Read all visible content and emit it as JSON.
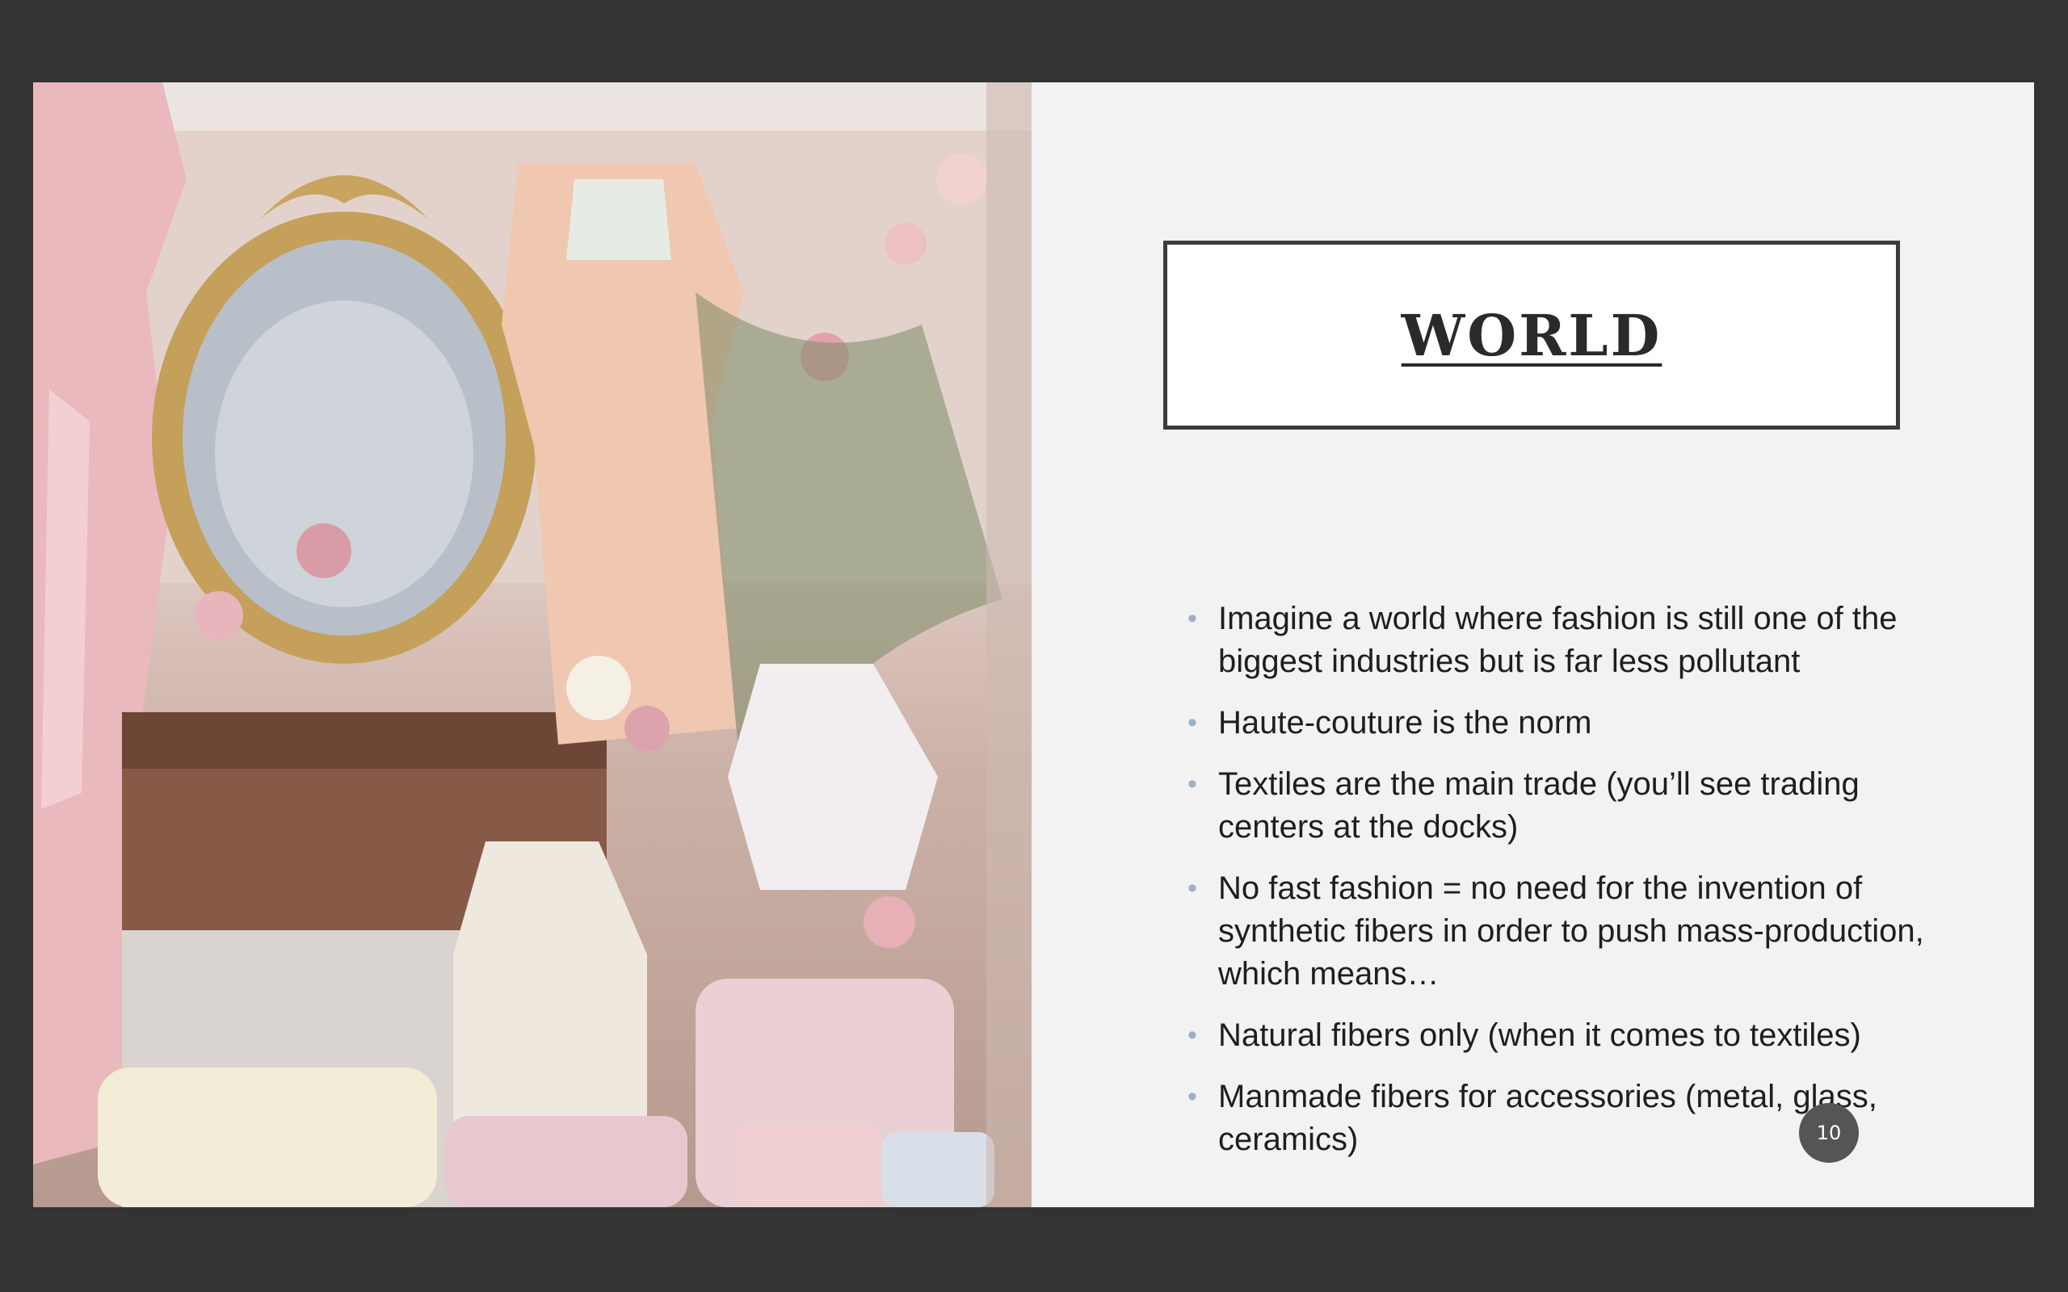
{
  "slide": {
    "title": "WORLD",
    "bullets": [
      "Imagine a world where fashion is still one of the biggest industries but is far less pollutant",
      "Haute-couture is the norm",
      "Textiles are the main trade (you’ll see trading centers at the docks)",
      "No fast fashion = no need for the invention of synthetic fibers in order to push mass-production, which means…",
      "Natural fibers only (when it comes to textiles)",
      "Manmade fibers for accessories (metal, glass, ceramics)"
    ],
    "page_number": "10"
  },
  "colors": {
    "background": "#333333",
    "slide": "#f2f2f2",
    "title_border": "#3b3b3b",
    "bullet": "#9fb0c4",
    "page_badge": "#555555"
  }
}
